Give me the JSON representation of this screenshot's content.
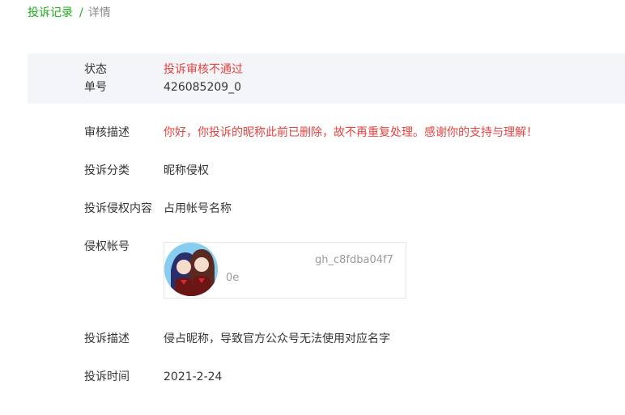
{
  "breadcrumb": {
    "parent": "投诉记录",
    "separator": "/",
    "current": "详情"
  },
  "status": {
    "label": "状态",
    "value": "投诉审核不通过",
    "number_label": "单号",
    "number_value": "426085209_0"
  },
  "details": {
    "review_label": "审核描述",
    "review_value": "你好，你投诉的昵称此前已删除，故不再重复处理。感谢你的支持与理解！",
    "category_label": "投诉分类",
    "category_value": "昵称侵权",
    "content_label": "投诉侵权内容",
    "content_value": "占用帐号名称",
    "account_label": "侵权帐号",
    "account_id": "gh_c8fdba04f7",
    "account_id_suffix": "0e",
    "desc_label": "投诉描述",
    "desc_value": "侵占昵称，导致官方公众号无法使用对应名字",
    "time_label": "投诉时间",
    "time_value": "2021-2-24"
  },
  "colors": {
    "accent": "#1aad19",
    "error": "#e64340",
    "status_bg": "#f4f5f9"
  }
}
